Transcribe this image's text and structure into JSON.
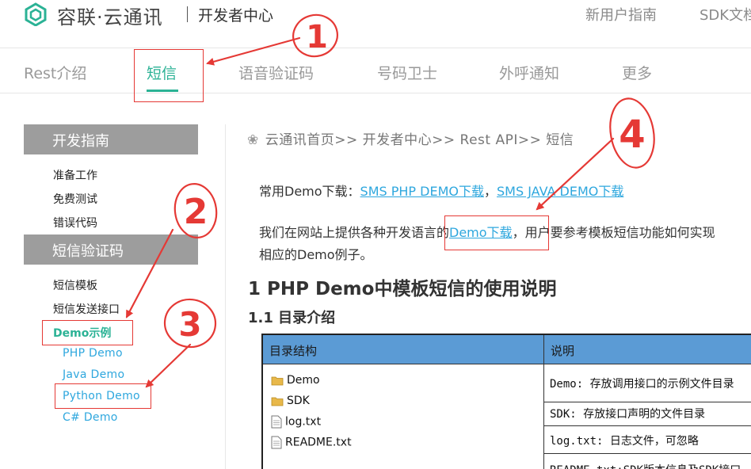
{
  "header": {
    "brand": "容联·云通讯",
    "sub_title": "开发者中心",
    "links": [
      "新用户指南",
      "SDK文档"
    ]
  },
  "tabs": [
    "Rest介绍",
    "短信",
    "语音验证码",
    "号码卫士",
    "外呼通知",
    "更多"
  ],
  "sidebar": {
    "section1_title": "开发指南",
    "section1_items": [
      "准备工作",
      "免费测试",
      "错误代码"
    ],
    "section2_title": "短信验证码",
    "section2_items": [
      "短信模板",
      "短信发送接口"
    ],
    "active_item": "Demo示例",
    "sub_items": [
      "PHP Demo",
      "Java Demo",
      "Python Demo",
      "C# Demo"
    ]
  },
  "breadcrumb": "云通讯首页>> 开发者中心>> Rest API>> 短信",
  "content": {
    "demo_label": "常用Demo下载：",
    "demo_link_php": "SMS PHP DEMO下载",
    "demo_sep": "，",
    "demo_link_java": "SMS JAVA DEMO下载",
    "intro_prefix": "我们在网站上提供各种开发语言的",
    "intro_link": "Demo下载",
    "intro_suffix": "，用户要参考模板短信功能如何实现",
    "intro_line2": "相应的Demo例子。",
    "h1": "1 PHP Demo中模板短信的使用说明",
    "h2": "1.1 目录介绍"
  },
  "table": {
    "col1_header": "目录结构",
    "col2_header": "说明",
    "files": [
      "Demo",
      "SDK",
      "log.txt",
      "README.txt"
    ],
    "descriptions": [
      "Demo: 存放调用接口的示例文件目录",
      "SDK:  存放接口声明的文件目录",
      "log.txt: 日志文件，可忽略",
      "README.txt:SDK版本信息及SDK接口"
    ]
  },
  "annotations": [
    "1",
    "2",
    "3",
    "4"
  ],
  "colors": {
    "accent_green": "#2bb295",
    "link_blue": "#2ea7de",
    "annotation_red": "#e53935",
    "sidebar_header_gray": "#9d9d9d",
    "table_header_blue": "#5b9bd5"
  }
}
